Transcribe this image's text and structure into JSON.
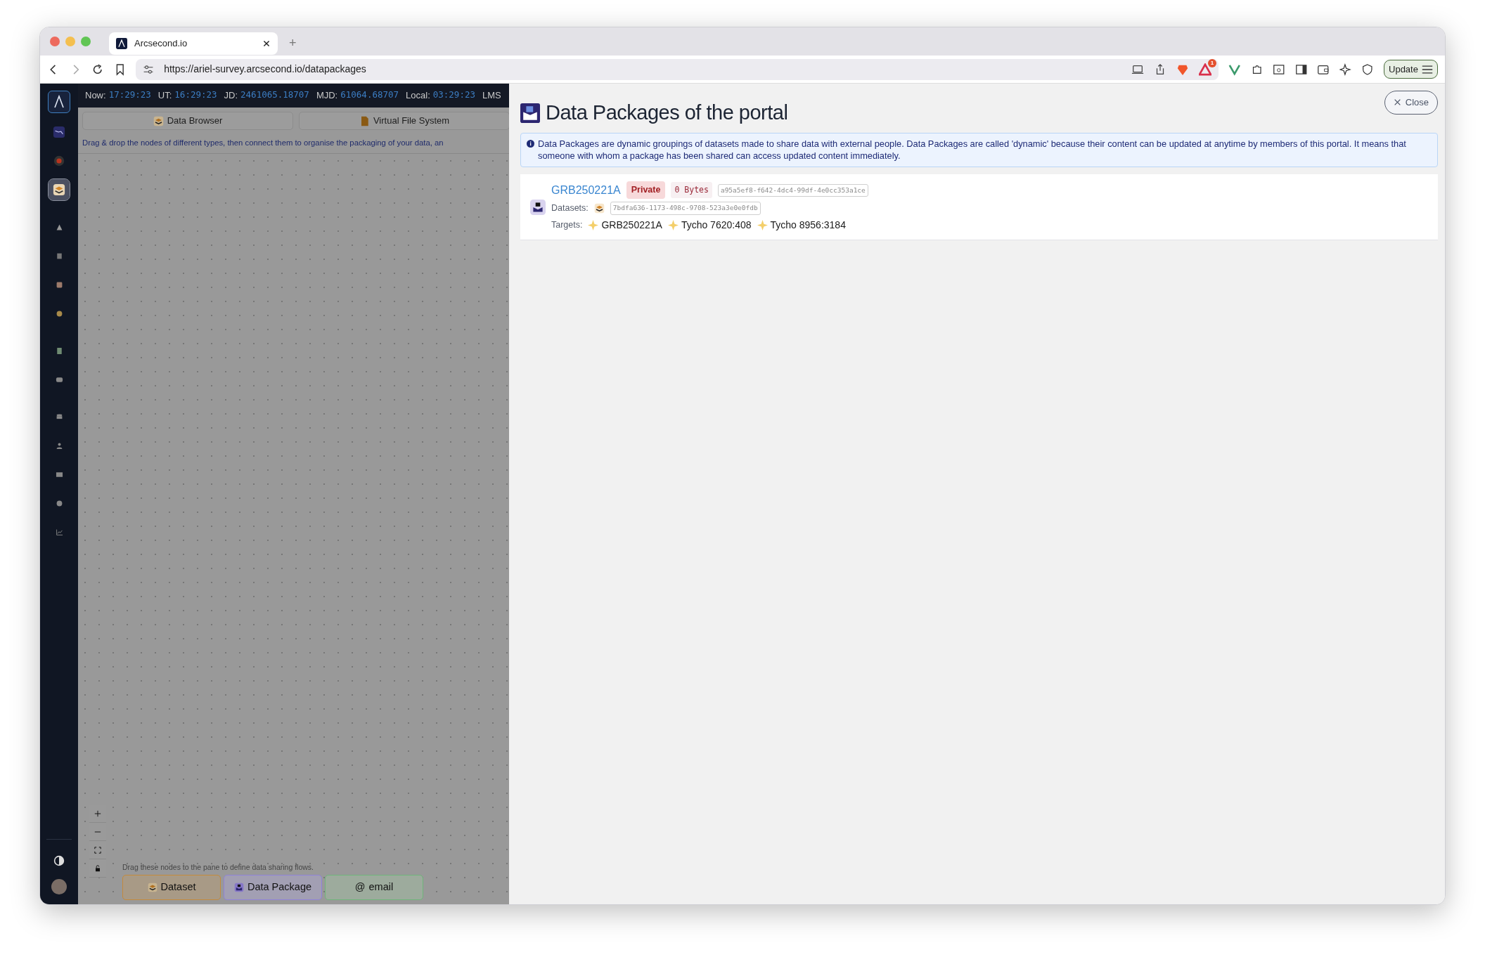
{
  "browser": {
    "tab_title": "Arcsecond.io",
    "new_tab": "+",
    "url": "https://ariel-survey.arcsecond.io/datapackages",
    "notification_count": "1",
    "update_button": "Update"
  },
  "clock": [
    {
      "label": "Now:",
      "value": "17:29:23"
    },
    {
      "label": "UT:",
      "value": "16:29:23"
    },
    {
      "label": "JD:",
      "value": "2461065.18707"
    },
    {
      "label": "MJD:",
      "value": "61064.68707"
    },
    {
      "label": "Local:",
      "value": "03:29:23"
    },
    {
      "label": "LMS"
    }
  ],
  "sidebar": {
    "items": [
      {
        "selected": false
      },
      {
        "selected": false
      },
      {
        "selected": true
      },
      {
        "selected": false
      },
      {
        "selected": false
      },
      {
        "selected": false
      },
      {
        "selected": false
      },
      {
        "selected": false
      },
      {
        "selected": false
      },
      {
        "selected": false
      },
      {
        "selected": false
      },
      {
        "selected": false
      },
      {
        "selected": false
      },
      {
        "selected": false
      }
    ]
  },
  "left_pane": {
    "tabs": [
      {
        "kind": "browser",
        "label": "Data Browser"
      },
      {
        "kind": "files",
        "label": "Virtual File System"
      }
    ],
    "hint": "Drag & drop the nodes of different types, then connect them to organise the packaging of your data, an",
    "palette_hint": "Drag these nodes to the pane to define data sharing flows.",
    "nodes": [
      {
        "kind": "dataset",
        "label": "Dataset"
      },
      {
        "kind": "package",
        "label": "Data Package"
      },
      {
        "kind": "email",
        "symbol": "@",
        "label": "email"
      }
    ]
  },
  "panel": {
    "title": "Data Packages of the portal",
    "close": "Close",
    "info": "Data Packages are dynamic groupings of datasets made to share data with external people. Data Packages are called 'dynamic' because their content can be updated at anytime by members of this portal. It means that someone with whom a package has been shared can access updated content immediately.",
    "packages": [
      {
        "name": "GRB250221A",
        "visibility": "Private",
        "size": "0 Bytes",
        "uuid": "a95a5ef8-f642-4dc4-99df-4e0cc353a1ce",
        "datasets_label": "Datasets:",
        "datasets": [
          "7bdfa636-1173-498c-9708-523a3e0e0fdb"
        ],
        "targets_label": "Targets:",
        "targets": [
          "GRB250221A",
          "Tycho 7620:408",
          "Tycho 8956:3184"
        ]
      }
    ]
  }
}
